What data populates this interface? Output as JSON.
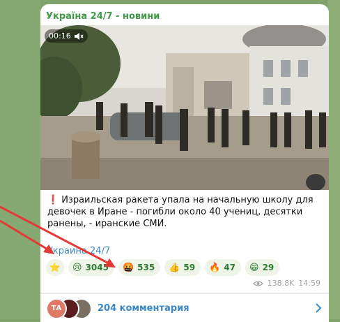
{
  "channel": {
    "name": "Україна 24/7 - новини"
  },
  "video": {
    "duration": "00:16",
    "muted": true
  },
  "post": {
    "exclamation": "❗",
    "text": "Израильская ракета упала на начальную школу для девочек в Иране - погибли около 40 учениц, десятки ранены, - иранские СМИ.",
    "source_link": "Украина 24/7"
  },
  "reactions": [
    {
      "emoji": "⭐",
      "count": ""
    },
    {
      "emoji": "😢",
      "count": "3045"
    },
    {
      "emoji": "🤬",
      "count": "535"
    },
    {
      "emoji": "👍",
      "count": "59"
    },
    {
      "emoji": "🔥",
      "count": "47"
    },
    {
      "emoji": "😁",
      "count": "29"
    }
  ],
  "meta": {
    "views": "138.8K",
    "time": "14:59"
  },
  "comments": {
    "avatar_initials": "ТА",
    "label": "204 комментария"
  },
  "colors": {
    "channel": "#3f9a4a",
    "link": "#3a88c7",
    "arrow": "#e53935",
    "background": "#7fa36a"
  },
  "icons": [
    "mute-icon",
    "eye-icon",
    "chevron-right-icon"
  ]
}
